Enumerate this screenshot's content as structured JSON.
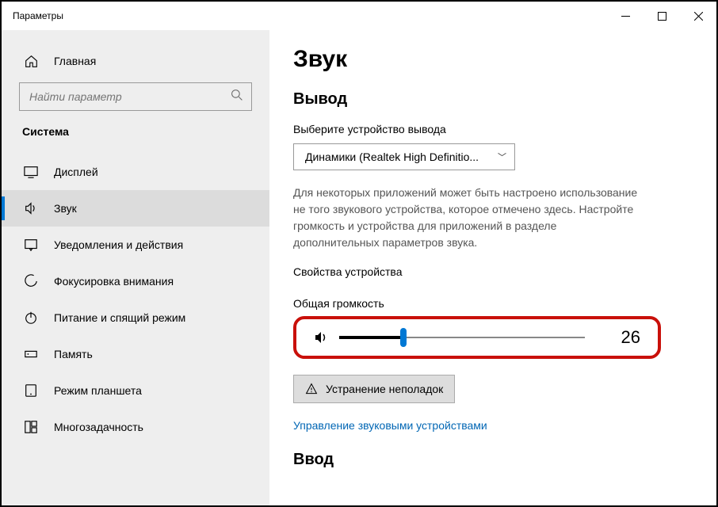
{
  "window": {
    "title": "Параметры"
  },
  "sidebar": {
    "home": "Главная",
    "search_placeholder": "Найти параметр",
    "section": "Система",
    "items": [
      {
        "label": "Дисплей"
      },
      {
        "label": "Звук"
      },
      {
        "label": "Уведомления и действия"
      },
      {
        "label": "Фокусировка внимания"
      },
      {
        "label": "Питание и спящий режим"
      },
      {
        "label": "Память"
      },
      {
        "label": "Режим планшета"
      },
      {
        "label": "Многозадачность"
      }
    ]
  },
  "main": {
    "title": "Звук",
    "output_heading": "Вывод",
    "output_device_label": "Выберите устройство вывода",
    "output_device_value": "Динамики (Realtek High Definitio...",
    "output_description": "Для некоторых приложений может быть настроено использование не того звукового устройства, которое отмечено здесь. Настройте громкость и устройства для приложений в разделе дополнительных параметров звука.",
    "device_properties": "Свойства устройства",
    "master_volume_label": "Общая громкость",
    "volume_value": "26",
    "troubleshoot": "Устранение неполадок",
    "manage_devices": "Управление звуковыми устройствами",
    "input_heading": "Ввод"
  }
}
